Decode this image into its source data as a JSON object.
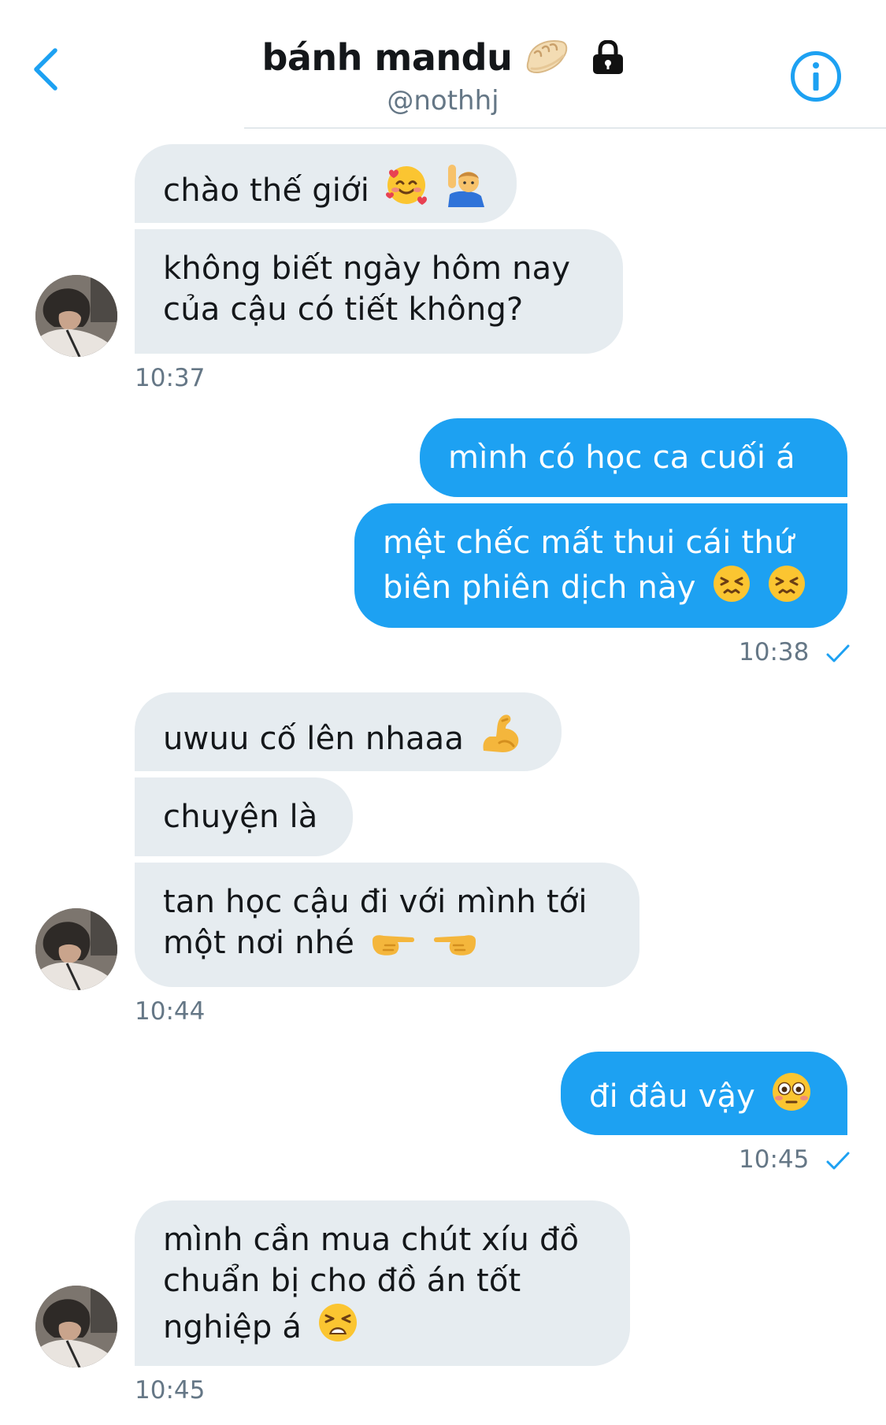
{
  "header": {
    "title": "bánh mandu",
    "title_emoji": "dumpling-emoji",
    "lock": "lock-icon",
    "handle": "@nothhj",
    "back_icon": "chevron-left-icon",
    "info_icon": "info-icon"
  },
  "colors": {
    "accent": "#1da1f2",
    "incoming_bubble": "#e6ecf0",
    "timestamp": "#657786"
  },
  "messages": [
    {
      "text": "chào thế giới",
      "emojis": [
        "smiling-face-with-hearts-emoji",
        "person-raising-hand-emoji"
      ]
    },
    {
      "text": "không biết ngày hôm nay của cậu có tiết không?"
    },
    {
      "time": "10:37"
    },
    {
      "text": "mình có học ca cuối á"
    },
    {
      "text": "mệt chếc mất thui cái thứ biên phiên dịch này",
      "emojis": [
        "persevering-face-emoji",
        "persevering-face-emoji"
      ]
    },
    {
      "time": "10:38"
    },
    {
      "text": "uwuu cố lên nhaaa",
      "emojis": [
        "flexed-biceps-emoji"
      ]
    },
    {
      "text": "chuyện là"
    },
    {
      "text": "tan học cậu đi với mình tới một nơi nhé",
      "emojis": [
        "pointing-right-emoji",
        "pointing-left-emoji"
      ]
    },
    {
      "time": "10:44"
    },
    {
      "text": "đi đâu vậy",
      "emojis": [
        "flushed-face-emoji"
      ]
    },
    {
      "time": "10:45"
    },
    {
      "text": "mình cần mua chút xíu đồ chuẩn bị cho đồ án tốt nghiệp á",
      "emojis": [
        "tired-face-emoji"
      ]
    },
    {
      "time": "10:45"
    }
  ]
}
